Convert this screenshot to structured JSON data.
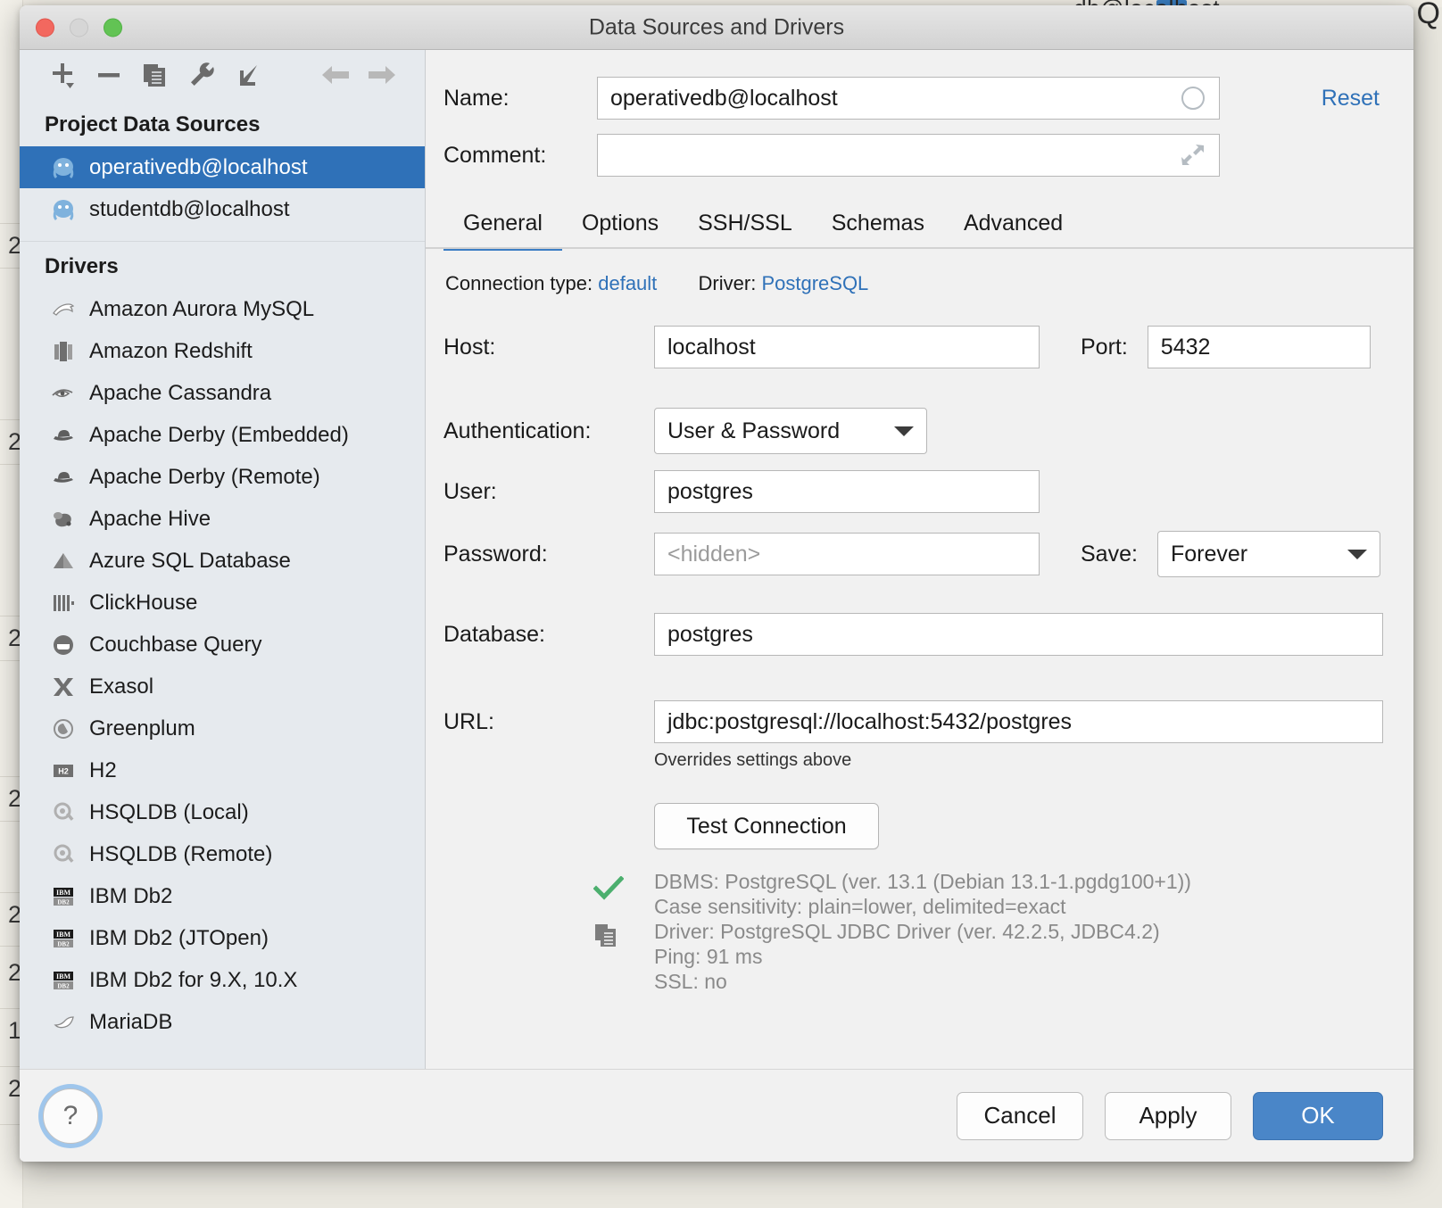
{
  "background": {
    "top_right_text": "Q",
    "center_text": "...db@localhost",
    "line_numbers": [
      "2",
      "2",
      "2",
      "2",
      "2",
      "2",
      "1",
      "2"
    ]
  },
  "window": {
    "title": "Data Sources and Drivers",
    "traffic_lights": [
      "close-button",
      "minimize-button",
      "zoom-button"
    ]
  },
  "sidebar": {
    "toolbar": [
      {
        "name": "add-button",
        "icon": "plus-icon"
      },
      {
        "name": "remove-button",
        "icon": "minus-icon"
      },
      {
        "name": "duplicate-button",
        "icon": "copy-icon"
      },
      {
        "name": "properties-button",
        "icon": "wrench-icon"
      },
      {
        "name": "import-button",
        "icon": "import-arrow-icon"
      },
      {
        "name": "back-button",
        "icon": "arrow-left-icon"
      },
      {
        "name": "forward-button",
        "icon": "arrow-right-icon"
      }
    ],
    "project_heading": "Project Data Sources",
    "data_sources": [
      {
        "label": "operativedb@localhost",
        "icon": "postgresql-icon",
        "selected": true
      },
      {
        "label": "studentdb@localhost",
        "icon": "postgresql-icon",
        "selected": false
      }
    ],
    "drivers_heading": "Drivers",
    "drivers": [
      {
        "label": "Amazon Aurora MySQL",
        "icon": "mysql-dolphin-icon"
      },
      {
        "label": "Amazon Redshift",
        "icon": "redshift-icon"
      },
      {
        "label": "Apache Cassandra",
        "icon": "cassandra-eye-icon"
      },
      {
        "label": "Apache Derby (Embedded)",
        "icon": "derby-hat-icon"
      },
      {
        "label": "Apache Derby (Remote)",
        "icon": "derby-hat-icon"
      },
      {
        "label": "Apache Hive",
        "icon": "hive-bee-icon"
      },
      {
        "label": "Azure SQL Database",
        "icon": "azure-icon"
      },
      {
        "label": "ClickHouse",
        "icon": "clickhouse-icon"
      },
      {
        "label": "Couchbase Query",
        "icon": "couchbase-icon"
      },
      {
        "label": "Exasol",
        "icon": "exasol-x-icon"
      },
      {
        "label": "Greenplum",
        "icon": "greenplum-icon"
      },
      {
        "label": "H2",
        "icon": "h2-icon"
      },
      {
        "label": "HSQLDB (Local)",
        "icon": "hsqldb-icon"
      },
      {
        "label": "HSQLDB (Remote)",
        "icon": "hsqldb-icon"
      },
      {
        "label": "IBM Db2",
        "icon": "db2-icon"
      },
      {
        "label": "IBM Db2 (JTOpen)",
        "icon": "db2-icon"
      },
      {
        "label": "IBM Db2 for 9.X, 10.X",
        "icon": "db2-icon"
      },
      {
        "label": "MariaDB",
        "icon": "mariadb-seal-icon"
      }
    ]
  },
  "form": {
    "name_label": "Name:",
    "name_value": "operativedb@localhost",
    "comment_label": "Comment:",
    "comment_value": "",
    "comment_placeholder": "",
    "reset_label": "Reset"
  },
  "tabs": [
    {
      "label": "General",
      "active": true
    },
    {
      "label": "Options",
      "active": false
    },
    {
      "label": "SSH/SSL",
      "active": false
    },
    {
      "label": "Schemas",
      "active": false
    },
    {
      "label": "Advanced",
      "active": false
    }
  ],
  "general": {
    "connection_type_label": "Connection type:",
    "connection_type_value": "default",
    "driver_label": "Driver:",
    "driver_value": "PostgreSQL",
    "host_label": "Host:",
    "host_value": "localhost",
    "port_label": "Port:",
    "port_value": "5432",
    "auth_label": "Authentication:",
    "auth_value": "User & Password",
    "user_label": "User:",
    "user_value": "postgres",
    "password_label": "Password:",
    "password_value": "<hidden>",
    "save_label": "Save:",
    "save_value": "Forever",
    "database_label": "Database:",
    "database_value": "postgres",
    "url_label": "URL:",
    "url_value": "jdbc:postgresql://localhost:5432/postgres",
    "url_hint": "Overrides settings above",
    "test_button": "Test Connection",
    "results": [
      "DBMS: PostgreSQL (ver. 13.1 (Debian 13.1-1.pgdg100+1))",
      "Case sensitivity: plain=lower, delimited=exact",
      "Driver: PostgreSQL JDBC Driver (ver. 42.2.5, JDBC4.2)",
      "Ping: 91 ms",
      "SSL: no"
    ],
    "result_status_icon": "green-check-icon",
    "result_copy_icon": "copy-icon"
  },
  "footer": {
    "help_label": "?",
    "cancel_label": "Cancel",
    "apply_label": "Apply",
    "ok_label": "OK"
  },
  "colors": {
    "accent_blue": "#2f71b8",
    "primary_button": "#4a86c8",
    "selection": "#2f71b8",
    "success_green": "#4caf6e",
    "sidebar_bg": "#e6eaee"
  }
}
